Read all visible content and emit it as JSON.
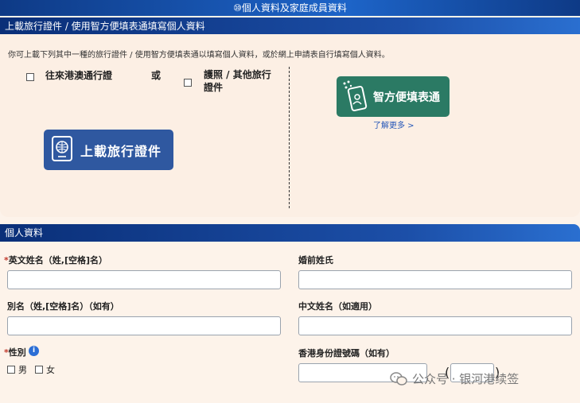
{
  "banner": {
    "title": "⑩個人資料及家庭成員資料"
  },
  "upload_section": {
    "header": "上載旅行證件 / 使用智方便填表通填寫個人資料",
    "hint": "你可上載下列其中一種的旅行證件 / 使用智方便填表通以填寫個人資料，或於網上申請表自行填寫個人資料。",
    "option1": "往來港澳通行證",
    "or": "或",
    "option2": "護照 / 其他旅行證件",
    "upload_button": "上載旅行證件",
    "iam_button": "智方便填表通",
    "learn_more": "了解更多 >"
  },
  "personal": {
    "header": "個人資料",
    "english_name": "英文姓名（姓,[空格]名）",
    "maiden_name": "婚前姓氏",
    "alias": "別名（姓,[空格]名）（如有）",
    "chinese_name": "中文姓名（如適用）",
    "gender": "性別",
    "male": "男",
    "female": "女",
    "hkid": "香港身份證號碼（如有）",
    "paren_open": "(",
    "paren_close": ")"
  },
  "watermark": {
    "text": "公众号 · 银河港续签"
  },
  "colors": {
    "primary_blue": "#1c4fa8",
    "iam_green": "#2b7a64",
    "required_red": "#c0392b"
  }
}
